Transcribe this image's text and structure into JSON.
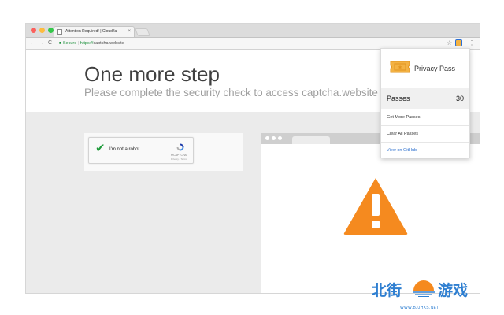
{
  "browser": {
    "tab_title": "Attention Required! | Cloudfla",
    "tab_close": "×",
    "address": {
      "secure_label": "Secure",
      "scheme": "https://",
      "host": "captcha.website"
    },
    "back_glyph": "←",
    "forward_glyph": "→",
    "reload_glyph": "C",
    "bookmark_icon": "star-icon",
    "extension_icon": "privacy-pass-icon"
  },
  "page": {
    "headline": "One more step",
    "subline": "Please complete the security check to access captcha.website"
  },
  "captcha": {
    "label": "I'm not a robot",
    "brand": "reCAPTCHA",
    "links": "Privacy - Terms",
    "checked": true
  },
  "popup": {
    "title": "Privacy Pass",
    "passes_label": "Passes",
    "passes_count": "30",
    "items": [
      {
        "label": "Get More Passes"
      },
      {
        "label": "Clear All Passes"
      },
      {
        "label": "View on GitHub"
      }
    ]
  },
  "watermark": {
    "left": "北街",
    "right": "游戏",
    "url": "WWW.BJJHXS.NET"
  },
  "colors": {
    "accent_orange": "#f58a1f",
    "secure_green": "#1a8f3a",
    "link_blue": "#2b6fce",
    "watermark_blue": "#2f7fd1"
  }
}
